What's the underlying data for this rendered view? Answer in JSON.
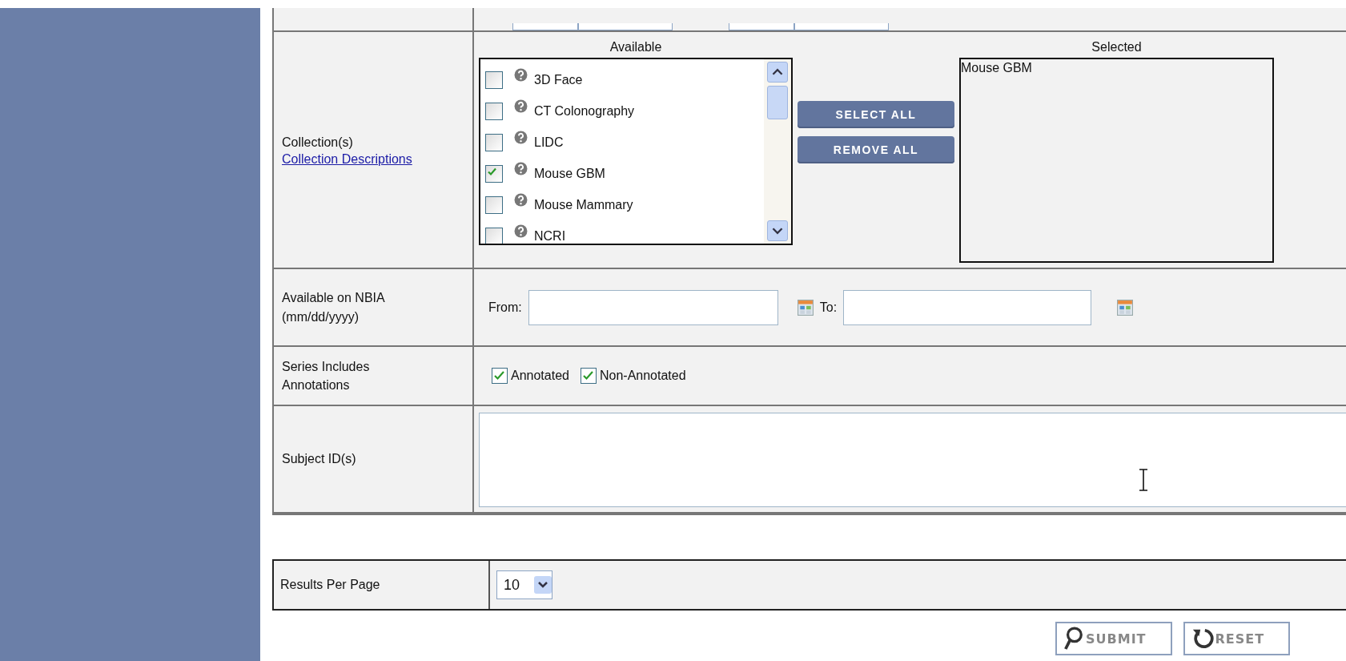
{
  "collections": {
    "label": "Collection(s)",
    "link": "Collection Descriptions",
    "available_heading": "Available",
    "selected_heading": "Selected",
    "available": [
      {
        "name": "3D Face",
        "checked": false
      },
      {
        "name": "CT Colonography",
        "checked": false
      },
      {
        "name": "LIDC",
        "checked": false
      },
      {
        "name": "Mouse GBM",
        "checked": true
      },
      {
        "name": "Mouse Mammary",
        "checked": false
      },
      {
        "name": "NCRI",
        "checked": false
      }
    ],
    "buttons": [
      "SELECT ALL",
      "REMOVE ALL"
    ],
    "selected": [
      "Mouse GBM"
    ]
  },
  "date": {
    "label": "Available on NBIA (mm/dd/yyyy)",
    "from_label": "From:",
    "to_label": "To:"
  },
  "annotations": {
    "label": "Series Includes Annotations",
    "options": [
      {
        "label": "Annotated",
        "checked": true
      },
      {
        "label": "Non-Annotated",
        "checked": true
      }
    ]
  },
  "subject": {
    "label": "Subject ID(s)"
  },
  "results": {
    "label": "Results Per Page",
    "value": "10"
  },
  "actions": [
    {
      "label": "SUBMIT",
      "kind": "search"
    },
    {
      "label": "RESET",
      "kind": "reset"
    }
  ]
}
